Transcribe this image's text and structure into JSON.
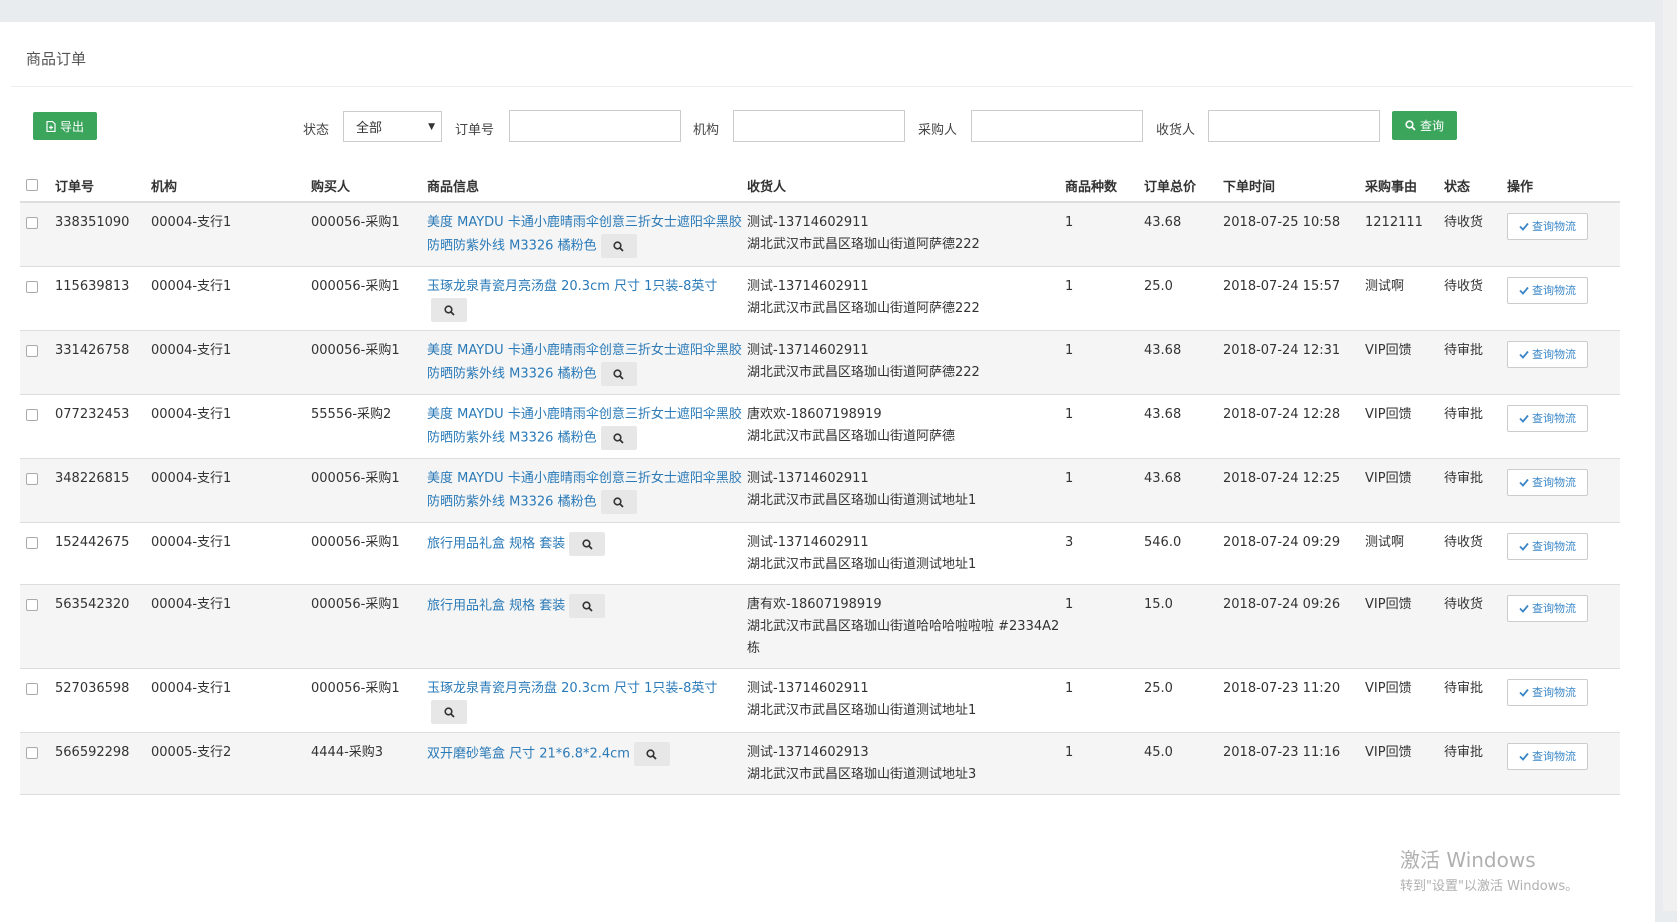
{
  "panel": {
    "title": "商品订单"
  },
  "toolbar": {
    "export_label": "导出",
    "status_label": "状态",
    "status_value": "全部",
    "order_no_label": "订单号",
    "org_label": "机构",
    "buyer_label": "采购人",
    "receiver_label": "收货人",
    "search_label": "查询"
  },
  "table": {
    "headers": [
      "订单号",
      "机构",
      "购买人",
      "商品信息",
      "收货人",
      "商品种数",
      "订单总价",
      "下单时间",
      "采购事由",
      "状态",
      "操作"
    ],
    "action_label": "查询物流",
    "rows": [
      {
        "order": "338351090",
        "org": "00004-支行1",
        "buyer": "000056-采购1",
        "product": "美度 MAYDU 卡通小鹿晴雨伞创意三折女士遮阳伞黑胶防晒防紫外线 M3326 橘粉色",
        "receiver": "测试-13714602911",
        "address": "湖北武汉市武昌区珞珈山街道阿萨德222",
        "kinds": "1",
        "total": "43.68",
        "time": "2018-07-25 10:58",
        "reason": "1212111",
        "status": "待收货"
      },
      {
        "order": "115639813",
        "org": "00004-支行1",
        "buyer": "000056-采购1",
        "product": "玉琢龙泉青瓷月亮汤盘 20.3cm 尺寸 1只装-8英寸",
        "receiver": "测试-13714602911",
        "address": "湖北武汉市武昌区珞珈山街道阿萨德222",
        "kinds": "1",
        "total": "25.0",
        "time": "2018-07-24 15:57",
        "reason": "测试啊",
        "status": "待收货"
      },
      {
        "order": "331426758",
        "org": "00004-支行1",
        "buyer": "000056-采购1",
        "product": "美度 MAYDU 卡通小鹿晴雨伞创意三折女士遮阳伞黑胶防晒防紫外线 M3326 橘粉色",
        "receiver": "测试-13714602911",
        "address": "湖北武汉市武昌区珞珈山街道阿萨德222",
        "kinds": "1",
        "total": "43.68",
        "time": "2018-07-24 12:31",
        "reason": "VIP回馈",
        "status": "待审批"
      },
      {
        "order": "077232453",
        "org": "00004-支行1",
        "buyer": "55556-采购2",
        "product": "美度 MAYDU 卡通小鹿晴雨伞创意三折女士遮阳伞黑胶防晒防紫外线 M3326 橘粉色",
        "receiver": "唐欢欢-18607198919",
        "address": "湖北武汉市武昌区珞珈山街道阿萨德",
        "kinds": "1",
        "total": "43.68",
        "time": "2018-07-24 12:28",
        "reason": "VIP回馈",
        "status": "待审批"
      },
      {
        "order": "348226815",
        "org": "00004-支行1",
        "buyer": "000056-采购1",
        "product": "美度 MAYDU 卡通小鹿晴雨伞创意三折女士遮阳伞黑胶防晒防紫外线 M3326 橘粉色",
        "receiver": "测试-13714602911",
        "address": "湖北武汉市武昌区珞珈山街道测试地址1",
        "kinds": "1",
        "total": "43.68",
        "time": "2018-07-24 12:25",
        "reason": "VIP回馈",
        "status": "待审批"
      },
      {
        "order": "152442675",
        "org": "00004-支行1",
        "buyer": "000056-采购1",
        "product": "旅行用品礼盒 规格 套装",
        "receiver": "测试-13714602911",
        "address": "湖北武汉市武昌区珞珈山街道测试地址1",
        "kinds": "3",
        "total": "546.0",
        "time": "2018-07-24 09:29",
        "reason": "测试啊",
        "status": "待收货"
      },
      {
        "order": "563542320",
        "org": "00004-支行1",
        "buyer": "000056-采购1",
        "product": "旅行用品礼盒 规格 套装",
        "receiver": "唐有欢-18607198919",
        "address": "湖北武汉市武昌区珞珈山街道哈哈哈啦啦啦 #2334A2栋",
        "kinds": "1",
        "total": "15.0",
        "time": "2018-07-24 09:26",
        "reason": "VIP回馈",
        "status": "待收货"
      },
      {
        "order": "527036598",
        "org": "00004-支行1",
        "buyer": "000056-采购1",
        "product": "玉琢龙泉青瓷月亮汤盘 20.3cm 尺寸 1只装-8英寸",
        "receiver": "测试-13714602911",
        "address": "湖北武汉市武昌区珞珈山街道测试地址1",
        "kinds": "1",
        "total": "25.0",
        "time": "2018-07-23 11:20",
        "reason": "VIP回馈",
        "status": "待审批"
      },
      {
        "order": "566592298",
        "org": "00005-支行2",
        "buyer": "4444-采购3",
        "product": "双开磨砂笔盒 尺寸 21*6.8*2.4cm",
        "receiver": "测试-13714602913",
        "address": "湖北武汉市武昌区珞珈山街道测试地址3",
        "kinds": "1",
        "total": "45.0",
        "time": "2018-07-23 11:16",
        "reason": "VIP回馈",
        "status": "待审批"
      }
    ]
  },
  "watermark": {
    "line1": "激活 Windows",
    "line2": "转到\"设置\"以激活 Windows。"
  },
  "colors": {
    "accent": "#3ba55c",
    "link": "#2a7ab8"
  }
}
